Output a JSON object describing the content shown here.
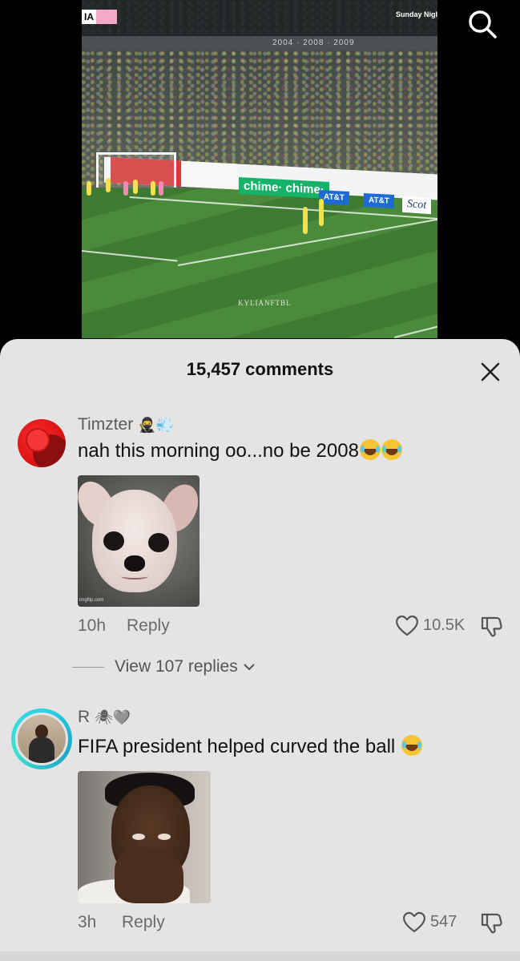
{
  "video": {
    "team_abbrev": "IA",
    "broadcast_label": "Sunday Night Soccer",
    "rail_years": "2004 · 2008 · 2009",
    "sponsor_chime": "chime· chime·",
    "sponsor_att": "AT&T",
    "sponsor_scot": "Scot",
    "watermark": "KYLIANFTBL",
    "search_icon": "search-icon"
  },
  "comments_panel": {
    "title": "15,457 comments",
    "close_icon": "close-icon",
    "comments": [
      {
        "username": "Timzter",
        "username_badges": "🥷💨",
        "text": "nah this morning oo...no be 2008",
        "emoji_count": 2,
        "gif_watermark": "imgflip.com",
        "time": "10h",
        "reply_label": "Reply",
        "likes": "10.5K",
        "view_replies": "View 107 replies"
      },
      {
        "username": "R",
        "username_badges": "🕷🩶",
        "text": "FIFA president helped curved the ball",
        "emoji_count": 1,
        "time": "3h",
        "reply_label": "Reply",
        "likes": "547"
      }
    ]
  },
  "colors": {
    "sheet_background": "#e4e4e4",
    "text_primary": "#111111",
    "text_secondary": "#6a6a6a",
    "avatar_ring": "#2fd3e6"
  }
}
